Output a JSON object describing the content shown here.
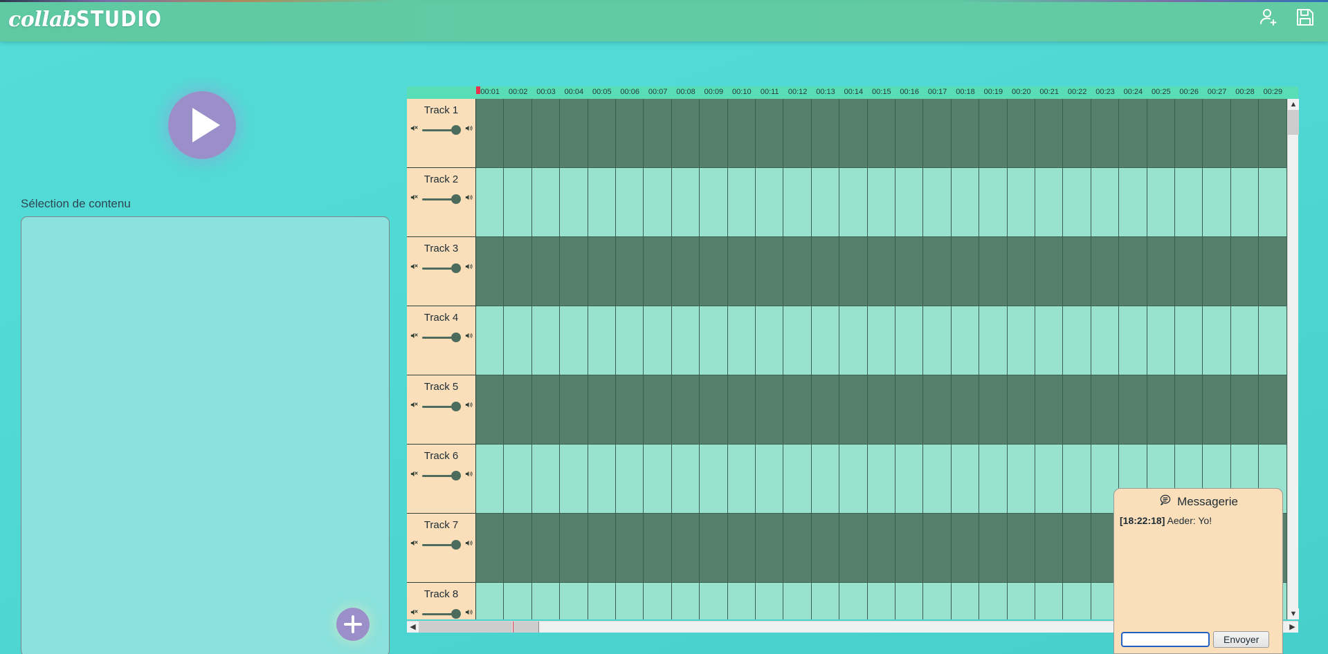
{
  "app": {
    "logo_script": "collab",
    "logo_block": "STUDIO",
    "accent_purple": "#9b8fc9",
    "accent_header_green": "#5fc9a3",
    "background_turquoise": "#51dad6",
    "track_dark": "#54806c",
    "track_light": "#99e2cd",
    "track_head_peach": "#fbdfbb",
    "playhead_red": "#e8314e"
  },
  "header": {
    "actions": [
      {
        "name": "add-user-icon",
        "label": "Ajouter un utilisateur"
      },
      {
        "name": "save-icon",
        "label": "Enregistrer"
      }
    ]
  },
  "left_panel": {
    "play_button_label": "Lecture",
    "content_section_label": "Sélection de contenu",
    "add_button_label": "+"
  },
  "timeline": {
    "ruler_ticks": [
      "00:01",
      "00:02",
      "00:03",
      "00:04",
      "00:05",
      "00:06",
      "00:07",
      "00:08",
      "00:09",
      "00:10",
      "00:11",
      "00:12",
      "00:13",
      "00:14",
      "00:15",
      "00:16",
      "00:17",
      "00:18",
      "00:19",
      "00:20",
      "00:21",
      "00:22",
      "00:23",
      "00:24",
      "00:25",
      "00:26",
      "00:27",
      "00:28",
      "00:29"
    ],
    "playhead_position": "00:00",
    "tracks": [
      {
        "name": "Track 1",
        "volume": 100,
        "muted": false
      },
      {
        "name": "Track 2",
        "volume": 100,
        "muted": false
      },
      {
        "name": "Track 3",
        "volume": 100,
        "muted": false
      },
      {
        "name": "Track 4",
        "volume": 100,
        "muted": false
      },
      {
        "name": "Track 5",
        "volume": 100,
        "muted": false
      },
      {
        "name": "Track 6",
        "volume": 100,
        "muted": false
      },
      {
        "name": "Track 7",
        "volume": 100,
        "muted": false
      },
      {
        "name": "Track 8",
        "volume": 100,
        "muted": false
      }
    ]
  },
  "messaging": {
    "title": "Messagerie",
    "messages": [
      {
        "time": "[18:22:18]",
        "body": "Aeder: Yo!"
      }
    ],
    "input_value": "",
    "send_label": "Envoyer"
  }
}
